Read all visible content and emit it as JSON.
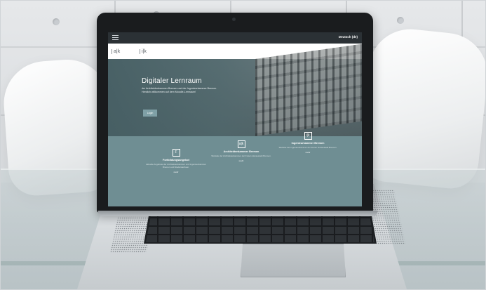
{
  "topbar": {
    "menu_icon": "hamburger-icon",
    "links": "",
    "language": "Deutsch (de)"
  },
  "logos": [
    {
      "mark": "a|k",
      "text": ""
    },
    {
      "mark": "i|k",
      "text": ""
    }
  ],
  "hero": {
    "title": "Digitaler Lernraum",
    "subtitle": "der Architektenkammer Bremen und der Ingenieurkammer Bremen. Herzlich willkommen auf dem Moodle-Lernraum!",
    "login_label": "Login"
  },
  "cards": [
    {
      "icon": "F",
      "title": "Fortbildungsangebot",
      "text": "Aktuelle Angebote der Architektenkammer und Ingenieurkammer Bremen und Niedersachsen.",
      "more": "mehr"
    },
    {
      "icon": "a|k",
      "title": "Architektenkammer Bremen",
      "text": "Website der Architektenkammer der Freien Hansestadt Bremen.",
      "more": "mehr"
    },
    {
      "icon": "i|k",
      "title": "Ingenieurkammer Bremen",
      "text": "Website der Ingenieurkammer der Freien Hansestadt Bremen.",
      "more": "mehr"
    }
  ],
  "colors": {
    "hero": "#5f7b80",
    "cards": "#6f8e93",
    "button": "#7fa0a6",
    "topbar": "#2b3135"
  }
}
